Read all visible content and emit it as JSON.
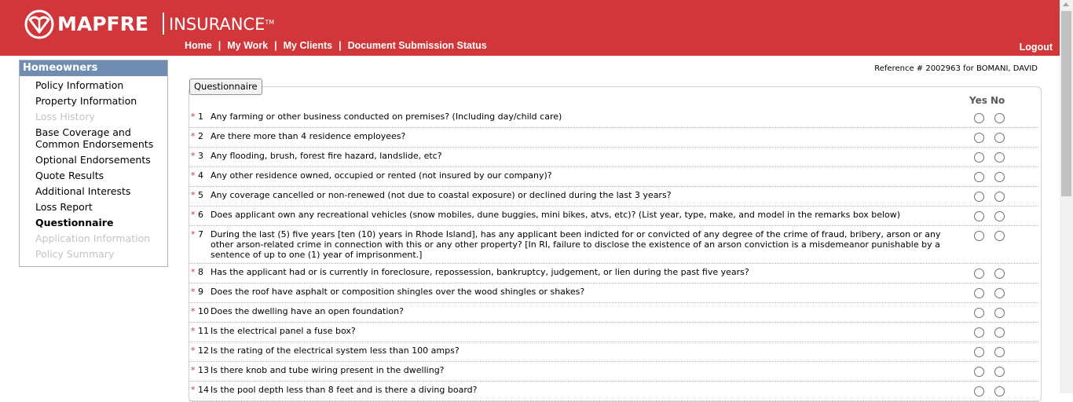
{
  "header": {
    "brand": "MAPFRE",
    "product": "INSURANCE",
    "trademark": "TM",
    "nav": [
      "Home",
      "My Work",
      "My Clients",
      "Document Submission Status"
    ],
    "logout": "Logout"
  },
  "sidebar": {
    "title": "Homeowners",
    "items": [
      {
        "label": "Policy Information",
        "state": "normal"
      },
      {
        "label": "Property Information",
        "state": "normal"
      },
      {
        "label": "Loss History",
        "state": "disabled"
      },
      {
        "label": "Base Coverage and Common Endorsements",
        "state": "normal"
      },
      {
        "label": "Optional Endorsements",
        "state": "normal"
      },
      {
        "label": "Quote Results",
        "state": "normal"
      },
      {
        "label": "Additional Interests",
        "state": "normal"
      },
      {
        "label": "Loss Report",
        "state": "normal"
      },
      {
        "label": "Questionnaire",
        "state": "active"
      },
      {
        "label": "Application Information",
        "state": "disabled"
      },
      {
        "label": "Policy Summary",
        "state": "disabled"
      }
    ]
  },
  "reference": "Reference # 2002963 for BOMANI, DAVID",
  "questionnaire": {
    "title": "Questionnaire",
    "yes_label": "Yes",
    "no_label": "No",
    "required_marker": "*",
    "questions": [
      {
        "num": "1",
        "text": "Any farming or other business conducted on premises? (Including day/child care)"
      },
      {
        "num": "2",
        "text": "Are there more than 4 residence employees?"
      },
      {
        "num": "3",
        "text": "Any flooding, brush, forest fire hazard, landslide, etc?"
      },
      {
        "num": "4",
        "text": "Any other residence owned, occupied or rented (not insured by our company)?"
      },
      {
        "num": "5",
        "text": "Any coverage cancelled or non-renewed (not due to coastal exposure) or declined during the last 3 years?"
      },
      {
        "num": "6",
        "text": "Does applicant own any recreational vehicles (snow mobiles, dune buggies, mini bikes, atvs, etc)? (List year, type, make, and model in the remarks box below)"
      },
      {
        "num": "7",
        "text": "During the last (5) five years [ten (10) years in Rhode Island], has any applicant been indicted for or convicted of any degree of the crime of fraud, bribery, arson or any other arson-related crime in connection with this or any other property? [In RI, failure to disclose the existence of an arson conviction is a misdemeanor punishable by a sentence of up to one (1) year of imprisonment.]"
      },
      {
        "num": "8",
        "text": "Has the applicant had or is currently in foreclosure, repossession, bankruptcy, judgement, or lien during the past five years?"
      },
      {
        "num": "9",
        "text": "Does the roof have asphalt or composition shingles over the wood shingles or shakes?"
      },
      {
        "num": "10",
        "text": "Does the dwelling have an open foundation?"
      },
      {
        "num": "11",
        "text": "Is the electrical panel a fuse box?"
      },
      {
        "num": "12",
        "text": "Is the rating of the electrical system less than 100 amps?"
      },
      {
        "num": "13",
        "text": "Is there knob and tube wiring present in the dwelling?"
      },
      {
        "num": "14",
        "text": "Is the pool depth less than 8 feet and is there a diving board?"
      }
    ]
  },
  "colors": {
    "header_bg": "#d1373a",
    "sidebar_title_bg": "#6e8db0",
    "disabled_text": "#c4c4c4",
    "required_star": "#d1373a"
  },
  "icons": {
    "logo": "mapfre-logo-icon",
    "radio": "radio-button-icon"
  }
}
